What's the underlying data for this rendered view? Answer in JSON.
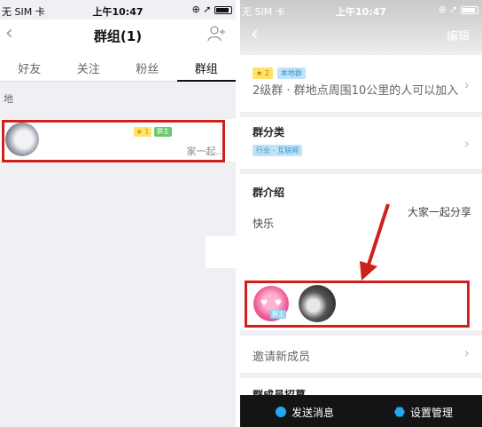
{
  "status": {
    "carrier": "无 SIM 卡",
    "time": "上午10:47"
  },
  "left": {
    "nav_title": "群组(1)",
    "tabs": [
      "好友",
      "关注",
      "粉丝",
      "群组"
    ],
    "section_label": "地",
    "group": {
      "name": "",
      "star_badge": "★ 1",
      "owner_badge": "群主",
      "preview": "家一起..."
    }
  },
  "right": {
    "edit": "编辑",
    "level_tag": "★ 2",
    "local_tag": "本地群",
    "group_desc": "2级群 · 群地点周围10公里的人可以加入",
    "category_title": "群分类",
    "category_tag": "行业 - 互联网",
    "intro_title": "群介绍",
    "intro_line1": "大家一起分享",
    "intro_line2": "快乐",
    "member_owner_badge": "群主",
    "invite": "邀请新成员",
    "recruit_title": "群成员招募",
    "bottom": {
      "send": "发送消息",
      "settings": "设置管理"
    }
  },
  "colors": {
    "highlight": "#d0201c",
    "accent": "#22a7f0",
    "bottom_bar": "#141414"
  }
}
